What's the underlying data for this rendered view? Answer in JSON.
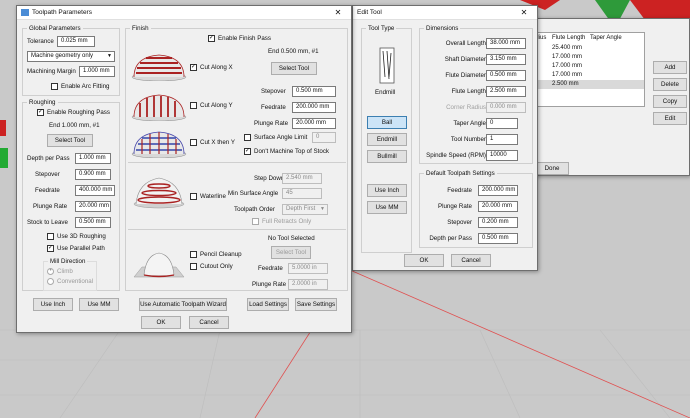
{
  "colors": {
    "canvas": "#c9c9c9",
    "accent": "#cc2222",
    "selection": "#cce4f7"
  },
  "toolpath": {
    "title": "Toolpath Parameters",
    "global": {
      "title": "Global Parameters",
      "tolerance_label": "Tolerance",
      "tolerance_value": "0.025 mm",
      "geometry_value": "Machine geometry only",
      "margin_label": "Machining Margin",
      "margin_value": "1.000 mm",
      "arc_label": "Enable Arc Fitting"
    },
    "roughing": {
      "title": "Roughing",
      "enable_label": "Enable Roughing Pass",
      "end_label": "End 1.000 mm, #1",
      "select_tool": "Select Tool",
      "depth_label": "Depth per Pass",
      "depth_value": "1.000 mm",
      "stepover_label": "Stepover",
      "stepover_value": "0.900 mm",
      "feedrate_label": "Feedrate",
      "feedrate_value": "400.000 mm",
      "plunge_label": "Plunge Rate",
      "plunge_value": "20.000 mm",
      "stock_label": "Stock to Leave",
      "stock_value": "0.500 mm",
      "use3d_label": "Use 3D Roughing",
      "parallel_label": "Use Parallel Path",
      "mill_dir_title": "Mill Direction",
      "climb_label": "Climb",
      "conv_label": "Conventional"
    },
    "finish": {
      "title": "Finish",
      "enable_label": "Enable Finish Pass",
      "end_label": "End 0.500 mm, #1",
      "select_tool": "Select Tool",
      "cut_x": "Cut Along X",
      "cut_y": "Cut Along Y",
      "cut_xy": "Cut X then Y",
      "stepover_label": "Stepover",
      "stepover_value": "0.500 mm",
      "feedrate_label": "Feedrate",
      "feedrate_value": "200.000 mm",
      "plunge_label": "Plunge Rate",
      "plunge_value": "20.000 mm",
      "surface_limit_label": "Surface Angle Limit",
      "surface_limit_value": "0",
      "dont_machine_label": "Don't Machine Top of Stock",
      "waterline_label": "Waterline",
      "step_down_label": "Step Down",
      "step_down_value": "2.540 mm",
      "min_angle_label": "Min Surface Angle",
      "min_angle_value": "45",
      "order_label": "Toolpath Order",
      "order_value": "Depth First",
      "full_retracts_label": "Full Retracts Only",
      "no_tool_label": "No Tool Selected",
      "select_tool2": "Select Tool",
      "pencil_label": "Pencil Cleanup",
      "cutout_label": "Cutout Only",
      "feed2_label": "Feedrate",
      "feed2_value": "5.0000 in",
      "plunge2_label": "Plunge Rate",
      "plunge2_value": "2.0000 in"
    },
    "buttons": {
      "use_inch": "Use Inch",
      "use_mm": "Use MM",
      "wizard": "Use Automatic Toolpath Wizard",
      "load": "Load Settings",
      "save": "Save Settings",
      "ok": "OK",
      "cancel": "Cancel"
    }
  },
  "edit_tool": {
    "title": "Edit Tool",
    "tool_type_title": "Tool Type",
    "endmill_caption": "Endmill",
    "types": [
      "Ball",
      "Endmill",
      "Bullmill"
    ],
    "use_inch": "Use Inch",
    "use_mm": "Use MM",
    "dimensions_title": "Dimensions",
    "dims": [
      {
        "label": "Overall Length",
        "value": "38.000 mm",
        "disabled": false
      },
      {
        "label": "Shaft Diameter",
        "value": "3.150 mm",
        "disabled": false
      },
      {
        "label": "Flute Diameter",
        "value": "0.500 mm",
        "disabled": false
      },
      {
        "label": "Flute Length",
        "value": "2.500 mm",
        "disabled": false
      },
      {
        "label": "Corner Radius",
        "value": "0.000 mm",
        "disabled": true
      },
      {
        "label": "Taper Angle",
        "value": "0",
        "disabled": false
      },
      {
        "label": "Tool Number",
        "value": "1",
        "disabled": false
      },
      {
        "label": "Spindle Speed (RPM)",
        "value": "10000",
        "disabled": false
      }
    ],
    "default_title": "Default Toolpath Settings",
    "defaults": [
      {
        "label": "Feedrate",
        "value": "200.000 mm"
      },
      {
        "label": "Plunge Rate",
        "value": "20.000 mm"
      },
      {
        "label": "Stepover",
        "value": "0.200 mm"
      },
      {
        "label": "Depth per Pass",
        "value": "0.500 mm"
      }
    ],
    "ok": "OK",
    "cancel": "Cancel"
  },
  "tool_library": {
    "columns": [
      "adius",
      "Flute Length",
      "Taper Angle"
    ],
    "rows": [
      "25.400 mm",
      "17.000 mm",
      "17.000 mm",
      "17.000 mm",
      "2.500 mm"
    ],
    "add": "Add",
    "delete": "Delete",
    "copy": "Copy",
    "edit": "Edit",
    "done": "Done"
  }
}
